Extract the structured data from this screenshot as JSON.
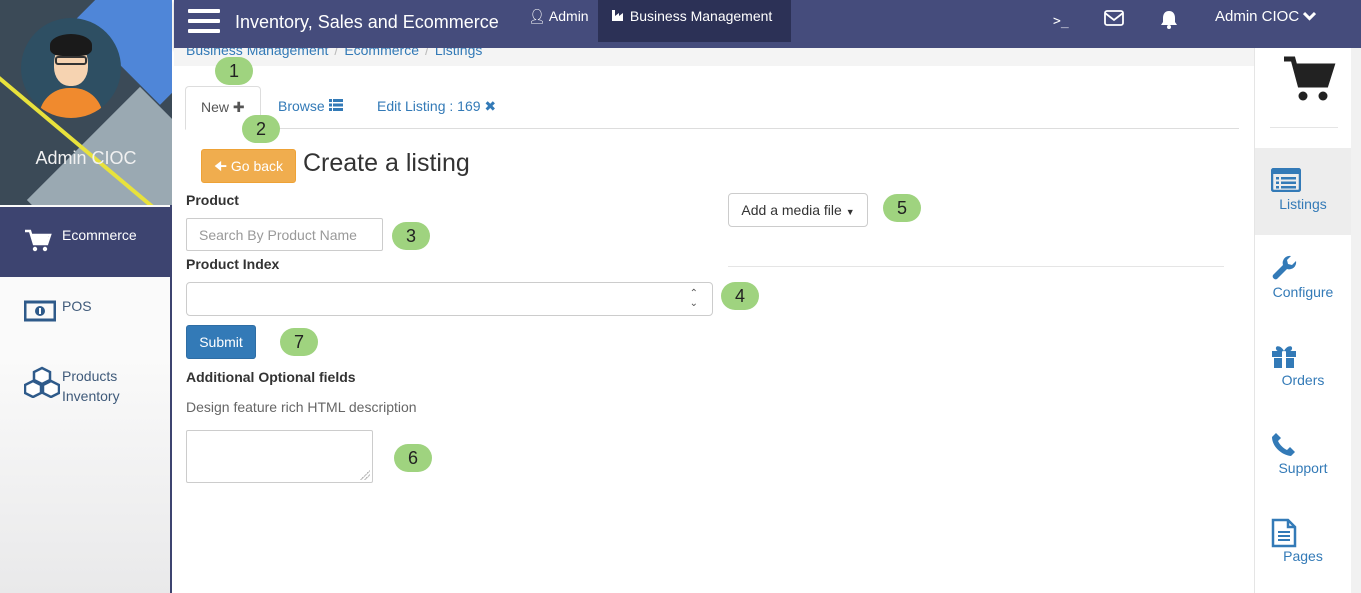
{
  "profile": {
    "name": "Admin CIOC"
  },
  "sidebar": {
    "items": [
      {
        "label": "Ecommerce",
        "icon": "cart-icon",
        "active": true
      },
      {
        "label": "POS",
        "icon": "money-icon"
      },
      {
        "label": "Products\nInventory",
        "icon": "cubes-icon"
      }
    ]
  },
  "topbar": {
    "title": "Inventory, Sales and Ecommerce",
    "admin_link": "Admin",
    "business_link": "Business Management",
    "terminal_icon": ">_",
    "user_menu": "Admin CIOC"
  },
  "breadcrumb": [
    "Business Management",
    "Ecommerce",
    "Listings"
  ],
  "tabs": [
    {
      "label": "New",
      "icon": "plus-icon",
      "active": true
    },
    {
      "label": "Browse",
      "icon": "list-icon"
    },
    {
      "label": "Edit Listing : 169",
      "icon": "close-icon"
    }
  ],
  "form": {
    "back_label": "Go back",
    "heading": "Create a listing",
    "product_label": "Product",
    "product_placeholder": "Search By Product Name",
    "index_label": "Product Index",
    "submit_label": "Submit",
    "optional_label": "Additional Optional fields",
    "html_label": "Design feature rich HTML description",
    "media_label": "Add a media file"
  },
  "annotations": [
    "1",
    "2",
    "3",
    "4",
    "5",
    "6",
    "7"
  ],
  "right_panel": {
    "items": [
      {
        "label": "Listings",
        "icon": "list-alt-icon",
        "active": true
      },
      {
        "label": "Configure",
        "icon": "wrench-icon"
      },
      {
        "label": "Orders",
        "icon": "gift-icon"
      },
      {
        "label": "Support",
        "icon": "phone-icon"
      },
      {
        "label": "Pages",
        "icon": "file-icon"
      }
    ]
  },
  "colors": {
    "navbar": "#454c7c",
    "accent": "#337ab7",
    "warning": "#f0ad4e",
    "badge": "#9fd37f"
  }
}
